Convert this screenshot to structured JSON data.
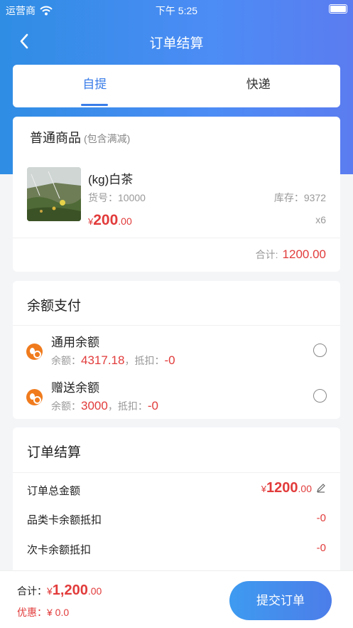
{
  "status": {
    "carrier": "运营商",
    "time": "下午 5:25"
  },
  "nav": {
    "title": "订单结算"
  },
  "tabs": [
    {
      "label": "自提",
      "active": true
    },
    {
      "label": "快递",
      "active": false
    }
  ],
  "goods": {
    "title": "普通商品",
    "subtitle": "(包含满减)",
    "item": {
      "name": "(kg)白茶",
      "code_label": "货号：",
      "code": "10000",
      "stock_label": "库存：",
      "stock": "9372",
      "currency": "¥",
      "price_int": "200",
      "price_dec": ".00",
      "qty": "x6"
    },
    "sum_label": "合计:",
    "sum_value": "1200.00"
  },
  "balance": {
    "title": "余额支付",
    "items": [
      {
        "name": "通用余额",
        "bal_label": "余额：",
        "bal": "4317.18",
        "ded_label": "，抵扣：",
        "ded": "-0",
        "icon": "coin-icon",
        "selected": false
      },
      {
        "name": "赠送余额",
        "bal_label": "余额：",
        "bal": "3000",
        "ded_label": "，抵扣：",
        "ded": "-0",
        "icon": "coin-icon",
        "selected": false
      }
    ]
  },
  "summary": {
    "title": "订单结算",
    "total_label": "订单总金额",
    "total_currency": "¥",
    "total_int": "1200",
    "total_dec": ".00",
    "rows": [
      {
        "label": "品类卡余额抵扣",
        "value": "-0"
      },
      {
        "label": "次卡余额抵扣",
        "value": "-0"
      }
    ]
  },
  "footer": {
    "total_label": "合计：",
    "total_currency": "¥",
    "total_int": "1,200",
    "total_dec": ".00",
    "discount_label": "优惠：",
    "discount_value": "¥ 0.0",
    "submit_label": "提交订单"
  },
  "colors": {
    "accent": "#3a7de8",
    "price": "#e23b3b",
    "coin": "#f07b1d"
  }
}
